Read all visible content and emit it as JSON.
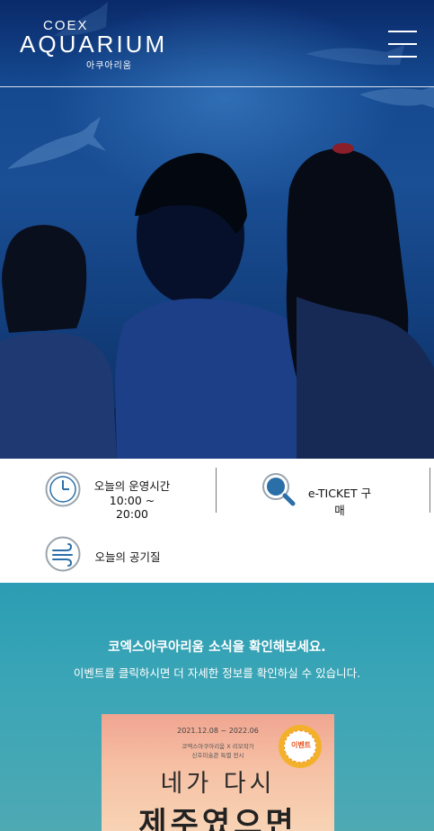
{
  "header": {
    "logo_top": "COEX",
    "logo_main": "AQUARIUM",
    "logo_sub": "아쿠아리움",
    "menu_icon": "hamburger-menu-icon"
  },
  "info": {
    "hours_label": "오늘의 운영시간",
    "hours_value": "10:00 ~ 20:00",
    "hours_icon": "clock-icon",
    "ticket_label": "e-TICKET 구매",
    "ticket_icon": "magnifier-icon",
    "air_label": "오늘의 공기질",
    "air_icon": "wind-icon"
  },
  "news": {
    "title": "코엑스아쿠아리움 소식을 확인해보세요.",
    "subtitle": "이벤트를 클릭하시면 더 자세한 정보를 확인하실 수 있습니다.",
    "poster": {
      "date": "2021.12.08 ~ 2022.06",
      "line1": "코엑스아쿠아리움 X 리모작가",
      "line2": "신호미술관 특별 전시",
      "title1": "네가 다시",
      "title2": "제주였으면",
      "badge": "이벤트"
    }
  },
  "colors": {
    "hero_blue": "#14488f",
    "news_teal": "#2b9db4",
    "icon_blue": "#2a6fa8"
  }
}
